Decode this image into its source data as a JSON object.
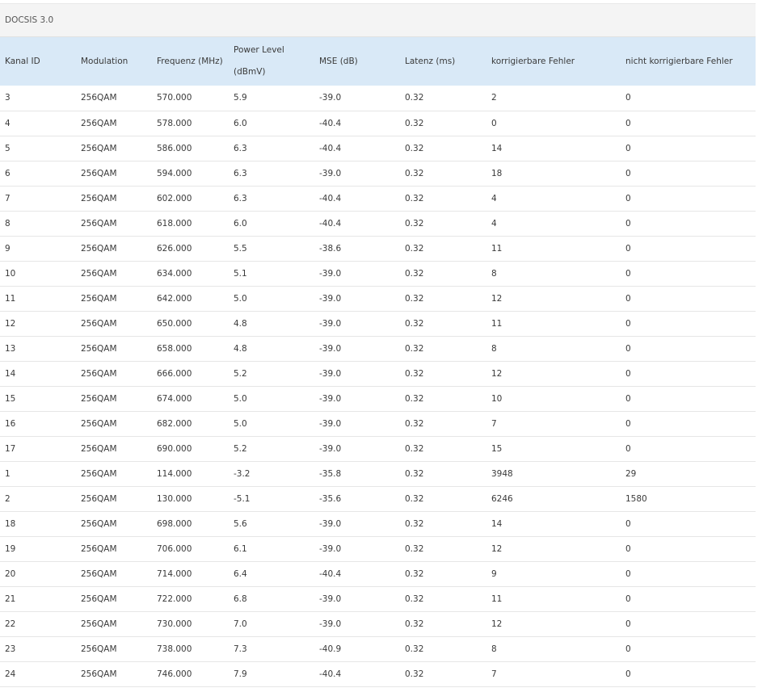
{
  "panel": {
    "title": "DOCSIS 3.0"
  },
  "table": {
    "columns": [
      "Kanal ID",
      "Modulation",
      "Frequenz (MHz)",
      "Power Level (dBmV)",
      "MSE (dB)",
      "Latenz (ms)",
      "korrigierbare Fehler",
      "nicht korrigierbare Fehler"
    ],
    "power_level_header": {
      "line1": "Power Level",
      "line2": "(dBmV)"
    },
    "rows": [
      [
        "3",
        "256QAM",
        "570.000",
        "5.9",
        "-39.0",
        "0.32",
        "2",
        "0"
      ],
      [
        "4",
        "256QAM",
        "578.000",
        "6.0",
        "-40.4",
        "0.32",
        "0",
        "0"
      ],
      [
        "5",
        "256QAM",
        "586.000",
        "6.3",
        "-40.4",
        "0.32",
        "14",
        "0"
      ],
      [
        "6",
        "256QAM",
        "594.000",
        "6.3",
        "-39.0",
        "0.32",
        "18",
        "0"
      ],
      [
        "7",
        "256QAM",
        "602.000",
        "6.3",
        "-40.4",
        "0.32",
        "4",
        "0"
      ],
      [
        "8",
        "256QAM",
        "618.000",
        "6.0",
        "-40.4",
        "0.32",
        "4",
        "0"
      ],
      [
        "9",
        "256QAM",
        "626.000",
        "5.5",
        "-38.6",
        "0.32",
        "11",
        "0"
      ],
      [
        "10",
        "256QAM",
        "634.000",
        "5.1",
        "-39.0",
        "0.32",
        "8",
        "0"
      ],
      [
        "11",
        "256QAM",
        "642.000",
        "5.0",
        "-39.0",
        "0.32",
        "12",
        "0"
      ],
      [
        "12",
        "256QAM",
        "650.000",
        "4.8",
        "-39.0",
        "0.32",
        "11",
        "0"
      ],
      [
        "13",
        "256QAM",
        "658.000",
        "4.8",
        "-39.0",
        "0.32",
        "8",
        "0"
      ],
      [
        "14",
        "256QAM",
        "666.000",
        "5.2",
        "-39.0",
        "0.32",
        "12",
        "0"
      ],
      [
        "15",
        "256QAM",
        "674.000",
        "5.0",
        "-39.0",
        "0.32",
        "10",
        "0"
      ],
      [
        "16",
        "256QAM",
        "682.000",
        "5.0",
        "-39.0",
        "0.32",
        "7",
        "0"
      ],
      [
        "17",
        "256QAM",
        "690.000",
        "5.2",
        "-39.0",
        "0.32",
        "15",
        "0"
      ],
      [
        "1",
        "256QAM",
        "114.000",
        "-3.2",
        "-35.8",
        "0.32",
        "3948",
        "29"
      ],
      [
        "2",
        "256QAM",
        "130.000",
        "-5.1",
        "-35.6",
        "0.32",
        "6246",
        "1580"
      ],
      [
        "18",
        "256QAM",
        "698.000",
        "5.6",
        "-39.0",
        "0.32",
        "14",
        "0"
      ],
      [
        "19",
        "256QAM",
        "706.000",
        "6.1",
        "-39.0",
        "0.32",
        "12",
        "0"
      ],
      [
        "20",
        "256QAM",
        "714.000",
        "6.4",
        "-40.4",
        "0.32",
        "9",
        "0"
      ],
      [
        "21",
        "256QAM",
        "722.000",
        "6.8",
        "-39.0",
        "0.32",
        "11",
        "0"
      ],
      [
        "22",
        "256QAM",
        "730.000",
        "7.0",
        "-39.0",
        "0.32",
        "12",
        "0"
      ],
      [
        "23",
        "256QAM",
        "738.000",
        "7.3",
        "-40.9",
        "0.32",
        "8",
        "0"
      ],
      [
        "24",
        "256QAM",
        "746.000",
        "7.9",
        "-40.4",
        "0.32",
        "7",
        "0"
      ]
    ]
  },
  "colors": {
    "header_bg": "#d9e9f7",
    "panel_header_bg": "#f4f4f4",
    "row_border": "#e6e6e6",
    "text": "#3a3a3a"
  }
}
